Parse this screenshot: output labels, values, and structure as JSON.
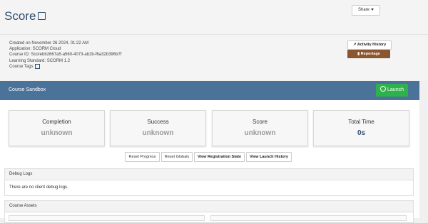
{
  "header": {
    "title": "Score",
    "share_label": "Share"
  },
  "meta": {
    "created": "Created on November 26 2024, 01:22 AM",
    "application": "Application: SCORM Cloud",
    "course_id": "Course ID: Scorebb2667a5-a560-4073-ab2b-f6a32b396b7f",
    "standard": "Learning Standard: SCORM 1.2",
    "tags": "Course Tags"
  },
  "actions": {
    "activity_history": "Activity History",
    "reportage": "Reportage"
  },
  "sandbox": {
    "title": "Course Sandbox",
    "launch_label": "Launch"
  },
  "cards": [
    {
      "label": "Completion",
      "value": "unknown"
    },
    {
      "label": "Success",
      "value": "unknown"
    },
    {
      "label": "Score",
      "value": "unknown"
    },
    {
      "label": "Total Time",
      "value": "0s"
    }
  ],
  "buttons": {
    "reset_progress": "Reset Progress",
    "reset_globals": "Reset Globals",
    "view_registration": "View Registration State",
    "view_launch_history": "View Launch History"
  },
  "debug": {
    "title": "Debug Logs",
    "body": "There are no client debug logs."
  },
  "assets": {
    "title": "Course Assets"
  },
  "colors": {
    "accent": "#4b7399",
    "launch": "#2eb24b",
    "reportage": "#8b5530"
  }
}
